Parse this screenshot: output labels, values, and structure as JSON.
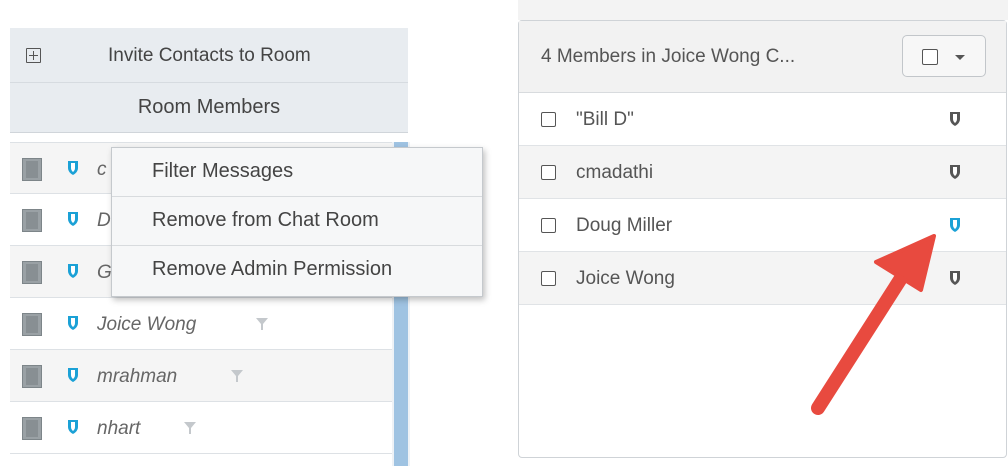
{
  "left_panel": {
    "invite_label": "Invite Contacts to Room",
    "room_members_label": "Room Members",
    "members": [
      {
        "name": "c"
      },
      {
        "name": "D"
      },
      {
        "name": "G"
      },
      {
        "name": "Joice Wong"
      },
      {
        "name": "mrahman"
      },
      {
        "name": "nhart"
      }
    ]
  },
  "context_menu": {
    "items": [
      "Filter Messages",
      "Remove from Chat Room",
      "Remove Admin Permission"
    ]
  },
  "right_panel": {
    "title": "4 Members in Joice Wong C...",
    "members": [
      {
        "name": "\"Bill D\"",
        "admin": false
      },
      {
        "name": "cmadathi",
        "admin": false
      },
      {
        "name": "Doug Miller",
        "admin": true
      },
      {
        "name": "Joice Wong",
        "admin": false
      }
    ]
  },
  "colors": {
    "admin_shield": "#1ba1d6",
    "member_shield": "#555555",
    "annotation_arrow": "#e84a3f",
    "scrollbar": "#9fc3e2"
  },
  "icons": {
    "plus": "plus-square-icon",
    "shield": "shield-icon",
    "filter": "filter-icon",
    "avatar": "avatar-chip-icon",
    "caret": "caret-down-icon"
  }
}
